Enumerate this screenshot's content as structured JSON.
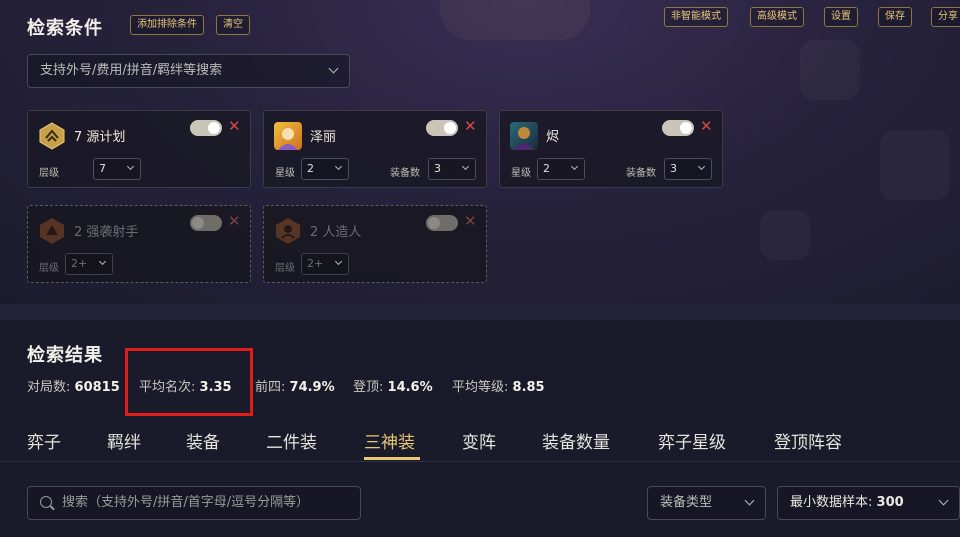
{
  "header": {
    "title": "检索条件",
    "add_exclude_label": "添加排除条件",
    "clear_label": "清空",
    "non_smart_mode_label": "非智能模式",
    "advanced_mode_label": "高级模式",
    "settings_label": "设置",
    "save_label": "保存",
    "share_label": "分享"
  },
  "search_select": {
    "placeholder": "支持外号/费用/拼音/羁绊等搜索"
  },
  "cards": [
    {
      "name": "7 源计划",
      "level_label": "层级",
      "level_value": "7",
      "enabled": true,
      "icon": "trait-project-icon"
    },
    {
      "name": "泽丽",
      "star_label": "星级",
      "star_value": "2",
      "equip_label": "装备数",
      "equip_value": "3",
      "enabled": true,
      "icon": "champion-zeri-icon"
    },
    {
      "name": "烬",
      "star_label": "星级",
      "star_value": "2",
      "equip_label": "装备数",
      "equip_value": "3",
      "enabled": true,
      "icon": "champion-jhin-icon"
    },
    {
      "name": "2 强袭射手",
      "level_label": "层级",
      "level_value": "2+",
      "enabled": false,
      "icon": "trait-sureshot-icon"
    },
    {
      "name": "2 人造人",
      "level_label": "层级",
      "level_value": "2+",
      "enabled": false,
      "icon": "trait-cybernetic-icon"
    }
  ],
  "results": {
    "title": "检索结果",
    "games_label": "对局数:",
    "games_value": "60815",
    "avg_rank_label": "平均名次:",
    "avg_rank_value": "3.35",
    "top4_label": "前四:",
    "top4_value": "74.9%",
    "top1_label": "登顶:",
    "top1_value": "14.6%",
    "avg_level_label": "平均等级:",
    "avg_level_value": "8.85"
  },
  "tabs": [
    "弈子",
    "羁绊",
    "装备",
    "二件装",
    "三神装",
    "变阵",
    "装备数量",
    "弈子星级",
    "登顶阵容"
  ],
  "active_tab": "三神装",
  "bottom_search": {
    "placeholder": "搜索（支持外号/拼音/首字母/逗号分隔等）"
  },
  "equip_type_select": {
    "label": "装备类型"
  },
  "min_sample_select": {
    "label": "最小数据样本:",
    "value": "300"
  },
  "colors": {
    "accent": "#e9c774",
    "highlight": "#e21b1b",
    "close": "#d24a4a"
  }
}
